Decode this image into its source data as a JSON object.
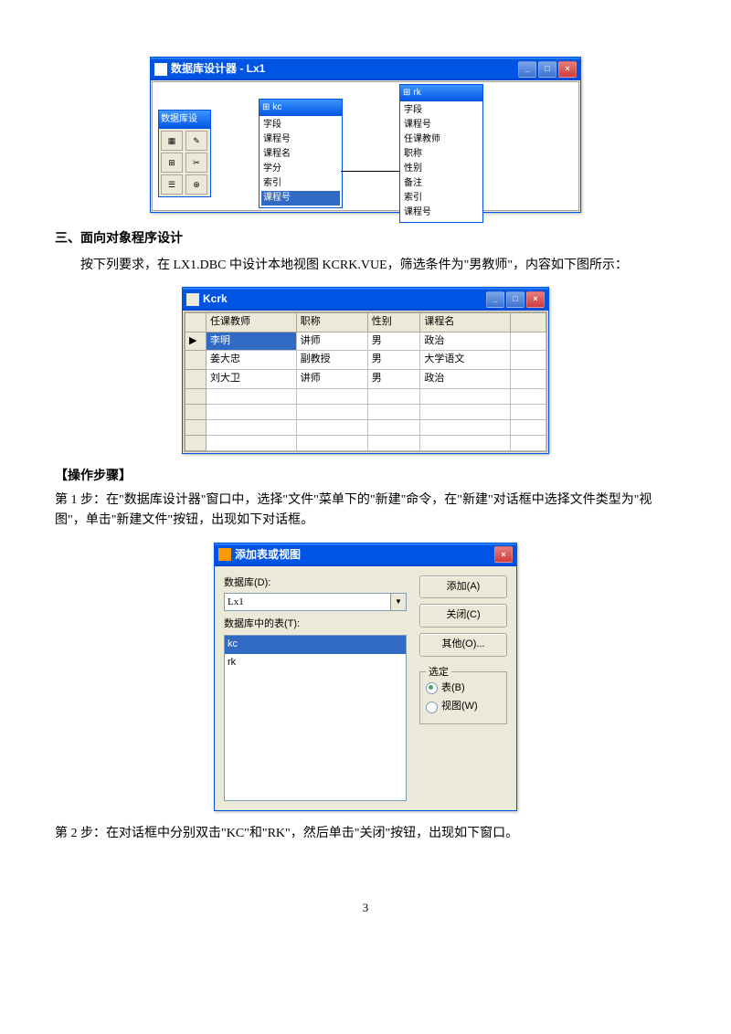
{
  "designer": {
    "title": "数据库设计器 - Lx1",
    "toolbox_title": "数据库设",
    "tb_icons": [
      "▦",
      "✎",
      "⊞",
      "✂",
      "☰",
      "⊕"
    ],
    "tables": [
      {
        "name": "kc",
        "fields": [
          "字段",
          "课程号",
          "课程名",
          "学分",
          "索引",
          "课程号"
        ]
      },
      {
        "name": "rk",
        "fields": [
          "字段",
          "课程号",
          "任课教师",
          "职称",
          "性别",
          "备注",
          "索引",
          "课程号"
        ]
      }
    ]
  },
  "section3": "三、面向对象程序设计",
  "para1": "按下列要求，在 LX1.DBC 中设计本地视图 KCRK.VUE，筛选条件为\"男教师\"，内容如下图所示：",
  "kcrk": {
    "title": "Kcrk",
    "columns": [
      "任课教师",
      "职称",
      "性别",
      "课程名"
    ],
    "rows": [
      [
        "李明",
        "讲师",
        "男",
        "政治"
      ],
      [
        "姜大忠",
        "副教授",
        "男",
        "大学语文"
      ],
      [
        "刘大卫",
        "讲师",
        "男",
        "政治"
      ]
    ]
  },
  "steps_title": "【操作步骤】",
  "step1": "第 1 步：在\"数据库设计器\"窗口中，选择\"文件\"菜单下的\"新建\"命令，在\"新建\"对话框中选择文件类型为\"视图\"，单击\"新建文件\"按钮，出现如下对话框。",
  "dialog": {
    "title": "添加表或视图",
    "db_label": "数据库(D):",
    "db_value": "Lx1",
    "tables_label": "数据库中的表(T):",
    "table_items": [
      "kc",
      "rk"
    ],
    "btn_add": "添加(A)",
    "btn_close": "关闭(C)",
    "btn_other": "其他(O)...",
    "group_title": "选定",
    "radio_table": "表(B)",
    "radio_view": "视图(W)"
  },
  "step2": "第 2 步：在对话框中分别双击\"KC\"和\"RK\"，然后单击\"关闭\"按钮，出现如下窗口。",
  "page": "3"
}
